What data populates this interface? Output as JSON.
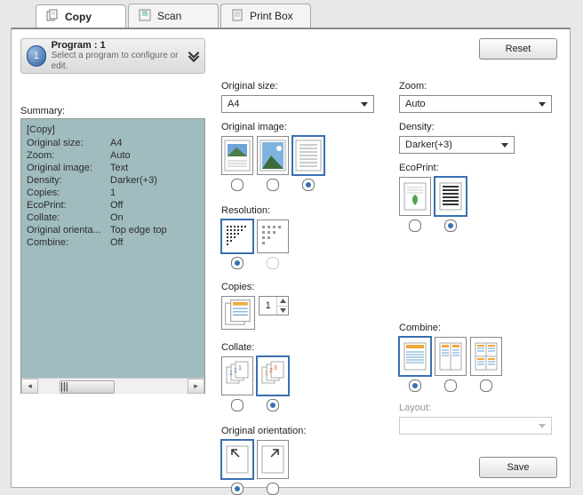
{
  "tabs": {
    "copy": "Copy",
    "scan": "Scan",
    "printbox": "Print Box"
  },
  "program": {
    "badge": "1",
    "title": "Program : 1",
    "sub": "Select a program to configure or edit."
  },
  "buttons": {
    "reset": "Reset",
    "save": "Save"
  },
  "summary": {
    "label": "Summary:",
    "head": "[Copy]",
    "rows": [
      {
        "k": "Original size:",
        "v": "A4"
      },
      {
        "k": "Zoom:",
        "v": "Auto"
      },
      {
        "k": "Original image:",
        "v": "Text"
      },
      {
        "k": "Density:",
        "v": "Darker(+3)"
      },
      {
        "k": "Copies:",
        "v": "1"
      },
      {
        "k": "EcoPrint:",
        "v": "Off"
      },
      {
        "k": "Collate:",
        "v": "On"
      },
      {
        "k": "Original orienta...",
        "v": "Top edge top"
      },
      {
        "k": "Combine:",
        "v": "Off"
      }
    ],
    "hscroll": "|||"
  },
  "labels": {
    "original_size": "Original size:",
    "original_image": "Original image:",
    "resolution": "Resolution:",
    "copies": "Copies:",
    "collate": "Collate:",
    "original_orientation": "Original orientation:",
    "zoom": "Zoom:",
    "density": "Density:",
    "ecoprint": "EcoPrint:",
    "combine": "Combine:",
    "layout": "Layout:"
  },
  "values": {
    "original_size": "A4",
    "zoom": "Auto",
    "density": "Darker(+3)",
    "copies": "1",
    "layout": ""
  },
  "state": {
    "original_image_selected": 2,
    "resolution_selected": 0,
    "collate_selected": 1,
    "orientation_selected": 0,
    "ecoprint_selected": 1,
    "combine_selected": 0,
    "resolution_option2_enabled": false,
    "layout_enabled": false
  }
}
